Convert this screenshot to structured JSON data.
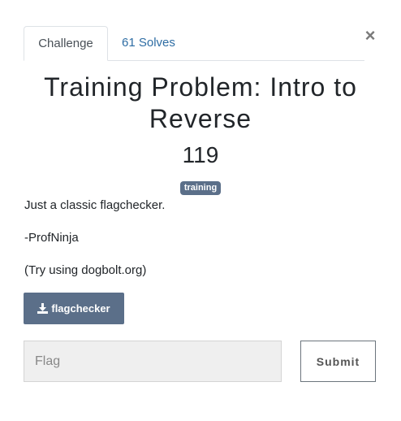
{
  "tabs": [
    {
      "label": "Challenge",
      "active": true
    },
    {
      "label": "61 Solves",
      "active": false
    }
  ],
  "close_icon": "×",
  "challenge": {
    "title": "Training Problem: Intro to Reverse",
    "points": "119",
    "tag": "training",
    "description": [
      "Just a classic flagchecker.",
      "-ProfNinja",
      "(Try using dogbolt.org)"
    ]
  },
  "file_button": {
    "label": "flagchecker",
    "icon": "download-icon"
  },
  "flag_form": {
    "placeholder": "Flag",
    "submit_label": "Submit"
  },
  "colors": {
    "accent": "#5b6f89",
    "link": "#2e6da4"
  }
}
